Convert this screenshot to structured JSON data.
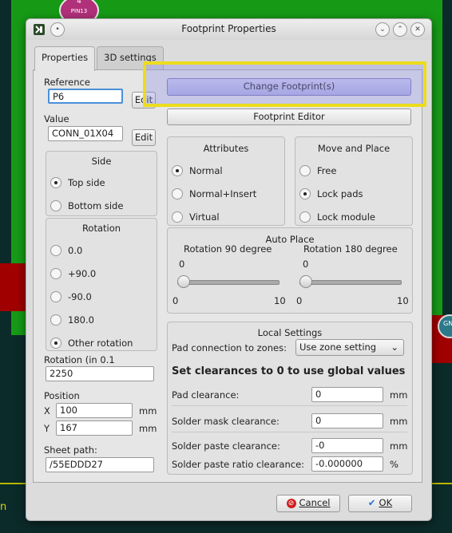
{
  "pcb": {
    "pad_top_label": "4",
    "pad_top_net": "PIN13",
    "pad_right_label": "GN",
    "edge_left_label": "n"
  },
  "dialog": {
    "title": "Footprint Properties",
    "title_buttons": {
      "minimize": "⌄",
      "maximize": "⌃",
      "close": "✕",
      "menu": "•"
    }
  },
  "tabs": [
    {
      "label": "Properties",
      "active": true
    },
    {
      "label": "3D settings",
      "active": false
    }
  ],
  "reference": {
    "label": "Reference",
    "value": "P6",
    "edit_label": "Edit"
  },
  "value": {
    "label": "Value",
    "value": "CONN_01X04",
    "edit_label": "Edit"
  },
  "side": {
    "title": "Side",
    "options": [
      "Top side",
      "Bottom side"
    ],
    "selected": "Top side"
  },
  "rotation": {
    "title": "Rotation",
    "options": [
      "0.0",
      "+90.0",
      "-90.0",
      "180.0",
      "Other rotation"
    ],
    "selected": "Other rotation"
  },
  "rotation_custom": {
    "label": "Rotation (in 0.1",
    "value": "2250"
  },
  "position": {
    "label": "Position",
    "x_label": "X",
    "x_value": "100",
    "y_label": "Y",
    "y_value": "167",
    "unit": "mm"
  },
  "sheet_path": {
    "label": "Sheet path:",
    "value": "/55EDDD27"
  },
  "change_footprint_label": "Change Footprint(s)",
  "footprint_editor_label": "Footprint Editor",
  "attributes": {
    "title": "Attributes",
    "options": [
      "Normal",
      "Normal+Insert",
      "Virtual"
    ],
    "selected": "Normal"
  },
  "move_place": {
    "title": "Move and Place",
    "options": [
      "Free",
      "Lock pads",
      "Lock module"
    ],
    "selected": "Lock pads"
  },
  "auto_place": {
    "title": "Auto Place",
    "rot90": {
      "label": "Rotation 90 degree",
      "value": "0",
      "min": "0",
      "max": "10",
      "level": 0
    },
    "rot180": {
      "label": "Rotation 180 degree",
      "value": "0",
      "min": "0",
      "max": "10",
      "level": 0
    }
  },
  "local_settings": {
    "title": "Local Settings",
    "pad_conn_label": "Pad connection to zones:",
    "pad_conn_value": "Use zone setting",
    "heading": "Set clearances to 0 to use global values",
    "rows": [
      {
        "label": "Pad clearance:",
        "value": "0",
        "unit": "mm"
      },
      {
        "label": "Solder mask clearance:",
        "value": "0",
        "unit": "mm"
      },
      {
        "label": "Solder paste clearance:",
        "value": "-0",
        "unit": "mm"
      },
      {
        "label": "Solder paste ratio clearance:",
        "value": "-0.000000",
        "unit": "%"
      }
    ]
  },
  "footer": {
    "cancel_label": "Cancel",
    "ok_label": "OK"
  },
  "colors": {
    "highlight": "#ecdc1c",
    "pcb_green": "#169a16",
    "pcb_red": "#a00000"
  }
}
